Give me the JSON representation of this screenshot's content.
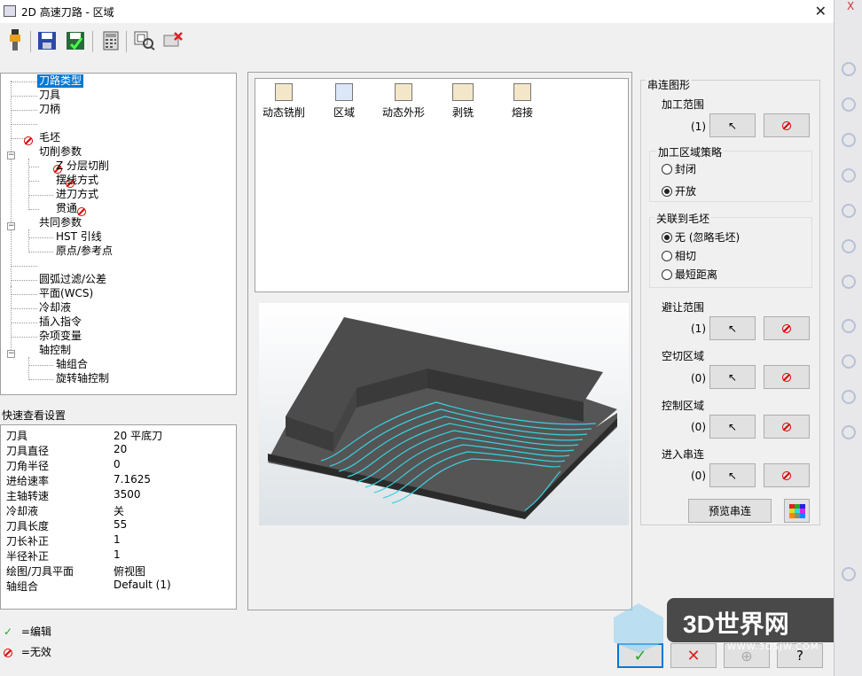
{
  "window": {
    "title": "2D 高速刀路 - 区域",
    "close": "✕"
  },
  "toolbar": {
    "buttons": [
      "tool-icon",
      "save-icon",
      "save-as-icon",
      "calculator-icon",
      "view-icon",
      "delete-icon"
    ]
  },
  "tree": {
    "items": [
      {
        "label": "刀路类型",
        "selected": true,
        "invalid": false
      },
      {
        "label": "刀具",
        "invalid": false
      },
      {
        "label": "刀柄",
        "invalid": false
      },
      {
        "label": "毛坯",
        "invalid": true
      },
      {
        "label": "切削参数",
        "invalid": false
      },
      {
        "label": "Z 分层切削",
        "invalid": true
      },
      {
        "label": "摆线方式",
        "invalid": true
      },
      {
        "label": "进刀方式",
        "invalid": false
      },
      {
        "label": "贯通",
        "invalid": true
      },
      {
        "label": "共同参数",
        "invalid": false
      },
      {
        "label": "HST 引线",
        "invalid": false
      },
      {
        "label": "原点/参考点",
        "invalid": false
      },
      {
        "label": "圆弧过滤/公差",
        "invalid": false
      },
      {
        "label": "平面(WCS)",
        "invalid": false
      },
      {
        "label": "冷却液",
        "invalid": false
      },
      {
        "label": "插入指令",
        "invalid": false
      },
      {
        "label": "杂项变量",
        "invalid": false
      },
      {
        "label": "轴控制",
        "invalid": false
      },
      {
        "label": "轴组合",
        "invalid": false
      },
      {
        "label": "旋转轴控制",
        "invalid": false
      }
    ]
  },
  "quick_view": {
    "title": "快速查看设置",
    "rows": [
      {
        "key": "刀具",
        "value": "20 平底刀"
      },
      {
        "key": "刀具直径",
        "value": "20"
      },
      {
        "key": "刀角半径",
        "value": "0"
      },
      {
        "key": "进给速率",
        "value": "7.1625"
      },
      {
        "key": "主轴转速",
        "value": "3500"
      },
      {
        "key": "冷却液",
        "value": "关"
      },
      {
        "key": "刀具长度",
        "value": "55"
      },
      {
        "key": "刀长补正",
        "value": "1"
      },
      {
        "key": "半径补正",
        "value": "1"
      },
      {
        "key": "绘图/刀具平面",
        "value": "俯视图"
      },
      {
        "key": "轴组合",
        "value": "Default (1)"
      }
    ]
  },
  "legend": {
    "edit": "=编辑",
    "invalid": "=无效"
  },
  "toolpath_types": [
    {
      "label": "动态铣削"
    },
    {
      "label": "区域"
    },
    {
      "label": "动态外形"
    },
    {
      "label": "剥铣"
    },
    {
      "label": "熔接"
    }
  ],
  "chain": {
    "group_title": "串连图形",
    "machining_range": {
      "label": "加工范围",
      "count": "(1)"
    },
    "strategy": {
      "title": "加工区域策略",
      "options": [
        "封闭",
        "开放"
      ],
      "selected": 1
    },
    "stock": {
      "title": "关联到毛坯",
      "options": [
        "无 (忽略毛坯)",
        "相切",
        "最短距离"
      ],
      "selected": 0
    },
    "avoid": {
      "label": "避让范围",
      "count": "(1)"
    },
    "air": {
      "label": "空切区域",
      "count": "(0)"
    },
    "control": {
      "label": "控制区域",
      "count": "(0)"
    },
    "entry": {
      "label": "进入串连",
      "count": "(0)"
    },
    "preview_button": "预览串连"
  },
  "watermark": {
    "text": "3D世界网",
    "sub": "WWW.3DSJW.COM"
  },
  "colors": {
    "selection": "#0078d7",
    "invalid": "#dd0000",
    "toolpath": "#3ad0e0",
    "part": "#4a4a4a"
  }
}
